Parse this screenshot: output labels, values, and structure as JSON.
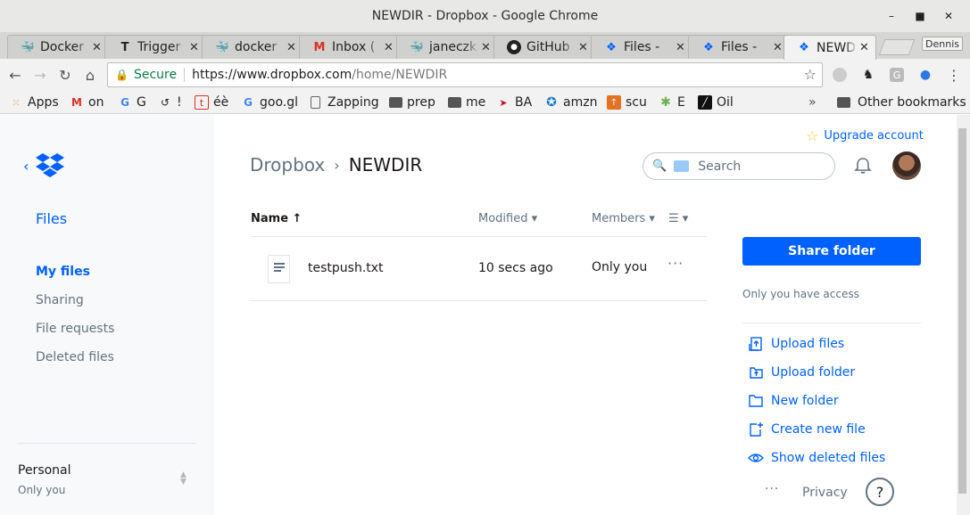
{
  "window": {
    "title": "NEWDIR - Dropbox - Google Chrome",
    "controls": [
      "–",
      "■",
      "✕"
    ]
  },
  "tabs": [
    {
      "label": "Docker",
      "icon": "docker-icon",
      "active": false
    },
    {
      "label": "Trigger",
      "icon": "funnel-icon",
      "active": false
    },
    {
      "label": "docker",
      "icon": "docker-icon",
      "active": false
    },
    {
      "label": "Inbox (",
      "icon": "gmail-icon",
      "active": false
    },
    {
      "label": "janeczk",
      "icon": "docker-icon",
      "active": false
    },
    {
      "label": "GitHub",
      "icon": "github-icon",
      "active": false
    },
    {
      "label": "Files - ",
      "icon": "dropbox-icon",
      "active": false
    },
    {
      "label": "Files - ",
      "icon": "dropbox-icon",
      "active": false
    },
    {
      "label": "NEWDIR",
      "icon": "dropbox-icon",
      "active": true
    }
  ],
  "tab_close": "✕",
  "profile": "Dennis",
  "omnibox": {
    "secure": "Secure",
    "url_host": "https://www.dropbox.com",
    "url_path": "/home/NEWDIR"
  },
  "bookmarks": {
    "items": [
      {
        "label": "Apps",
        "icon": "apps-grid-icon"
      },
      {
        "label": "on",
        "icon": "gmail-icon"
      },
      {
        "label": "G",
        "icon": "google-icon"
      },
      {
        "label": "!",
        "icon": "history-icon"
      },
      {
        "label": "éè",
        "icon": "t-icon"
      },
      {
        "label": "goo.gl",
        "icon": "google-icon"
      },
      {
        "label": "Zapping",
        "icon": "page-icon"
      },
      {
        "label": "prep",
        "icon": "folder-icon"
      },
      {
        "label": "me",
        "icon": "folder-icon"
      },
      {
        "label": "BA",
        "icon": "ba-icon"
      },
      {
        "label": "amzn",
        "icon": "chase-icon"
      },
      {
        "label": "scu",
        "icon": "scu-icon"
      },
      {
        "label": "E",
        "icon": "e-icon"
      },
      {
        "label": "Oil",
        "icon": "oil-icon"
      }
    ],
    "overflow": "»",
    "other": "Other bookmarks"
  },
  "sidebar": {
    "files": "Files",
    "items": [
      {
        "label": "My files",
        "active": true
      },
      {
        "label": "Sharing",
        "active": false
      },
      {
        "label": "File requests",
        "active": false
      },
      {
        "label": "Deleted files",
        "active": false
      }
    ],
    "account": "Personal",
    "account_sub": "Only you"
  },
  "main": {
    "breadcrumb_root": "Dropbox",
    "breadcrumb_sep": "›",
    "breadcrumb_current": "NEWDIR",
    "upgrade": "Upgrade account",
    "search_placeholder": "Search",
    "columns": {
      "name": "Name ↑",
      "modified": "Modified ▾",
      "members": "Members ▾",
      "view": "☰ ▾"
    },
    "files": [
      {
        "name": "testpush.txt",
        "modified": "10 secs ago",
        "members": "Only you",
        "more": "···"
      }
    ]
  },
  "panel": {
    "share_button": "Share folder",
    "access": "Only you have access",
    "actions": [
      {
        "label": "Upload files",
        "icon": "upload-files-icon"
      },
      {
        "label": "Upload folder",
        "icon": "upload-folder-icon"
      },
      {
        "label": "New folder",
        "icon": "new-folder-icon"
      },
      {
        "label": "Create new file",
        "icon": "create-file-icon"
      },
      {
        "label": "Show deleted files",
        "icon": "eye-icon"
      }
    ],
    "more": "···",
    "privacy": "Privacy",
    "help": "?"
  },
  "colors": {
    "accent": "#0061fe",
    "secure_green": "#0b8043",
    "muted": "#637282"
  }
}
